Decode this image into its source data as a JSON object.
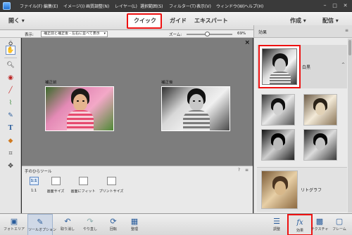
{
  "menubar": {
    "items": [
      "ファイル(F)",
      "編集(E)",
      "イメージ(I)",
      "画質調整(N)",
      "レイヤー(L)",
      "選択範囲(S)",
      "フィルター(T)",
      "表示(V)",
      "ウィンドウ(W)",
      "ヘルプ(H)"
    ],
    "window_controls": [
      "–",
      "□",
      "✕"
    ]
  },
  "modebar": {
    "open_label": "開く",
    "tabs": [
      {
        "label": "クイック"
      },
      {
        "label": "ガイド"
      },
      {
        "label": "エキスパート"
      }
    ],
    "create_label": "作成",
    "share_label": "配信"
  },
  "options": {
    "view_label": "表示:",
    "view_value": "補正前と補正後 - 左右に並べて表示",
    "zoom_label": "ズーム:",
    "zoom_value": "69%",
    "zoom_level": 0.69
  },
  "canvas": {
    "before_label": "補正前",
    "after_label": "補正後",
    "close_glyph": "×"
  },
  "tool_panel": {
    "title": "手のひらツール",
    "buttons": [
      {
        "label": "1:1",
        "icon": "actual-pixels-icon"
      },
      {
        "label": "画面サイズ",
        "icon": "fit-screen-icon"
      },
      {
        "label": "画面にフィット",
        "icon": "fill-screen-icon"
      },
      {
        "label": "プリントサイズ",
        "icon": "print-size-icon"
      }
    ]
  },
  "effects": {
    "title": "効果",
    "selected_label": "白黒",
    "sepia_label": "リトグラフ"
  },
  "bottombar": {
    "left": [
      {
        "label": "フォトエリア",
        "icon": "photo-bin-icon"
      },
      {
        "label": "ツールオプション",
        "icon": "tool-options-icon"
      },
      {
        "label": "取り消し",
        "icon": "undo-icon"
      },
      {
        "label": "やり直し",
        "icon": "redo-icon"
      },
      {
        "label": "回転",
        "icon": "rotate-icon"
      },
      {
        "label": "整理",
        "icon": "organize-icon"
      }
    ],
    "right": [
      {
        "label": "調整",
        "icon": "adjustments-icon"
      },
      {
        "label": "効果",
        "icon": "effects-icon"
      },
      {
        "label": "テクスチャ",
        "icon": "texture-icon"
      },
      {
        "label": "フレーム",
        "icon": "frame-icon"
      }
    ]
  },
  "colors": {
    "highlight": "#e11111",
    "accent": "#2a5d9c"
  }
}
